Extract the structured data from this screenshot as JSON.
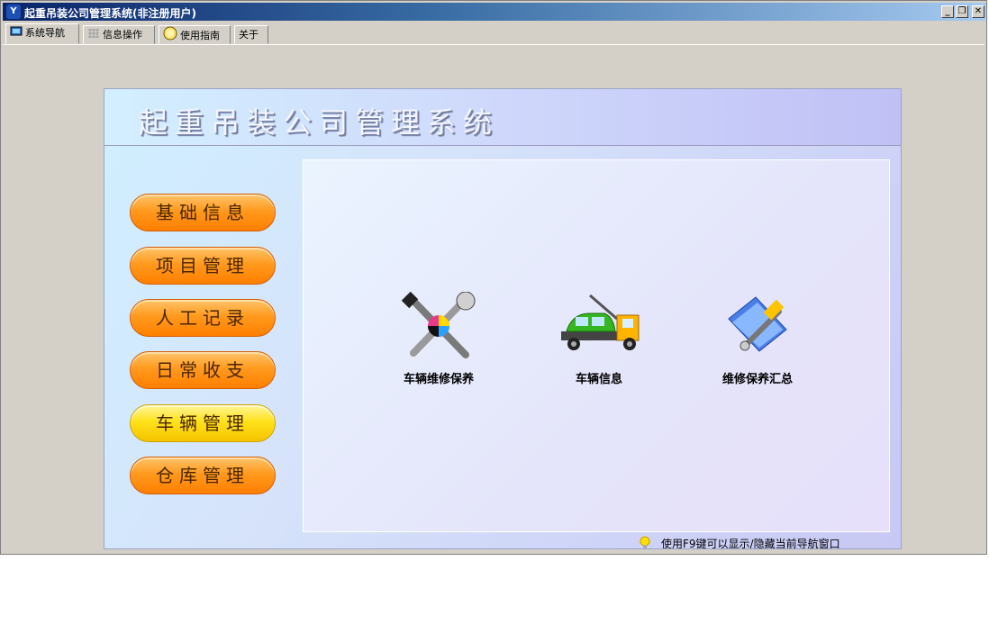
{
  "window": {
    "title": "起重吊装公司管理系统(非注册用户)",
    "controls": {
      "minimize": "_",
      "restore": "❐",
      "close": "✕"
    }
  },
  "tabs": [
    {
      "label": "系统导航",
      "active": true,
      "icon": "monitor-icon"
    },
    {
      "label": "信息操作",
      "active": false,
      "icon": "grid-icon"
    },
    {
      "label": "使用指南",
      "active": false,
      "icon": "help-icon"
    },
    {
      "label": "关于",
      "active": false,
      "icon": ""
    }
  ],
  "header": {
    "title": "起重吊装公司管理系统"
  },
  "menu": [
    {
      "label": "基础信息",
      "style": "orange"
    },
    {
      "label": "项目管理",
      "style": "orange"
    },
    {
      "label": "人工记录",
      "style": "orange"
    },
    {
      "label": "日常收支",
      "style": "orange"
    },
    {
      "label": "车辆管理",
      "style": "yellow"
    },
    {
      "label": "仓库管理",
      "style": "orange"
    }
  ],
  "features": [
    {
      "label": "车辆维修保养",
      "icon": "tools-icon"
    },
    {
      "label": "车辆信息",
      "icon": "tow-truck-icon"
    },
    {
      "label": "维修保养汇总",
      "icon": "summary-icon"
    }
  ],
  "hint": "使用F9键可以显示/隐藏当前导航窗口",
  "colors": {
    "titlebar": "#0a246a",
    "menu_orange": "#ff9a1e",
    "menu_yellow": "#ffe21a"
  }
}
